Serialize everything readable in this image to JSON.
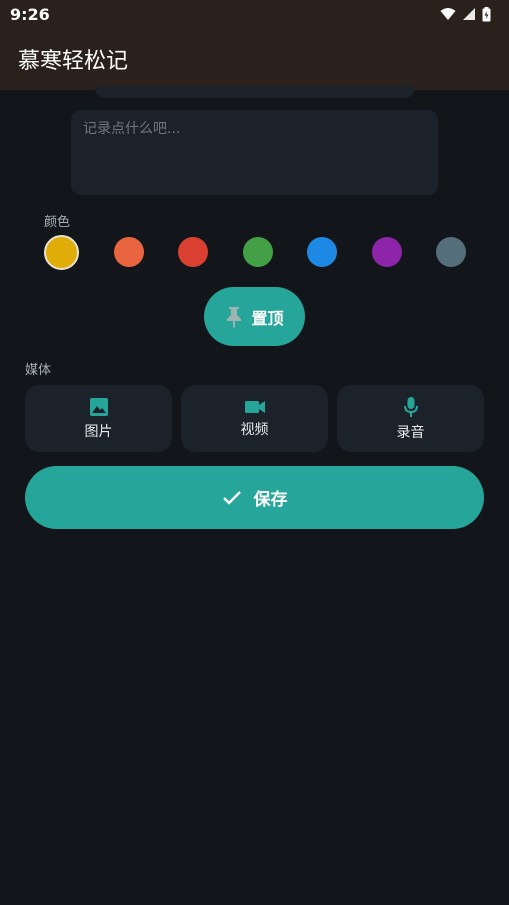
{
  "status_bar": {
    "time": "9:26"
  },
  "app_bar": {
    "title": "慕寒轻松记"
  },
  "editor": {
    "content_placeholder": "记录点什么吧..."
  },
  "color_section": {
    "label": "颜色",
    "swatches": [
      {
        "color": "#e0ad08",
        "selected": true
      },
      {
        "color": "#e8653f"
      },
      {
        "color": "#d9402f"
      },
      {
        "color": "#43a047"
      },
      {
        "color": "#1e88e5"
      },
      {
        "color": "#8e24aa"
      },
      {
        "color": "#546e7a"
      }
    ]
  },
  "pin_button": {
    "label": "置顶",
    "icon": "pin-icon"
  },
  "media_section": {
    "label": "媒体",
    "buttons": [
      {
        "label": "图片",
        "icon": "image-icon"
      },
      {
        "label": "视频",
        "icon": "video-icon"
      },
      {
        "label": "录音",
        "icon": "mic-icon"
      }
    ]
  },
  "save_button": {
    "label": "保存",
    "icon": "check-icon"
  },
  "theme": {
    "accent": "#26a69a",
    "background": "#12161a",
    "surface": "#1c2229",
    "app_bar": "#2a211d"
  }
}
